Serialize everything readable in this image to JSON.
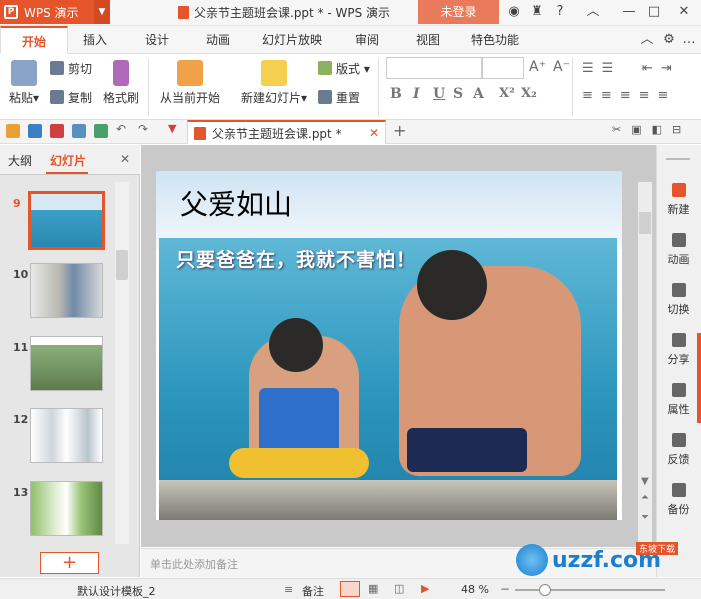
{
  "app": {
    "name": "WPS 演示",
    "login": "未登录"
  },
  "window": {
    "title": "父亲节主题班会课.ppt * - WPS 演示"
  },
  "menu": {
    "tabs": [
      "开始",
      "插入",
      "设计",
      "动画",
      "幻灯片放映",
      "审阅",
      "视图",
      "特色功能"
    ]
  },
  "ribbon": {
    "paste": "粘贴",
    "cut": "剪切",
    "copy": "复制",
    "format_painter": "格式刷",
    "from_current": "从当前开始",
    "new_slide": "新建幻灯片",
    "layout": "版式",
    "reset": "重置",
    "format_buttons": [
      "B",
      "I",
      "U",
      "S",
      "A",
      "X²",
      "X₂"
    ]
  },
  "doc_tab": {
    "label": "父亲节主题班会课.ppt *"
  },
  "left_panel": {
    "tabs": [
      "大纲",
      "幻灯片"
    ],
    "slides": [
      {
        "num": "9",
        "selected": true
      },
      {
        "num": "10",
        "selected": false
      },
      {
        "num": "11",
        "selected": false
      },
      {
        "num": "12",
        "selected": false
      },
      {
        "num": "13",
        "selected": false
      }
    ],
    "add_label": "+"
  },
  "slide": {
    "title": "父爱如山",
    "caption": "只要爸爸在，我就不害怕！"
  },
  "right_panel": {
    "items": [
      "新建",
      "动画",
      "切换",
      "分享",
      "属性",
      "反馈",
      "备份"
    ]
  },
  "notes": {
    "placeholder": "单击此处添加备注"
  },
  "status": {
    "template": "默认设计模板_2",
    "notes": "备注",
    "zoom": "48 %"
  },
  "watermark": {
    "text": "uzzf.com",
    "tag": "东坡下载"
  },
  "colors": {
    "accent": "#e4552b",
    "login_bg": "#e97b5c"
  }
}
